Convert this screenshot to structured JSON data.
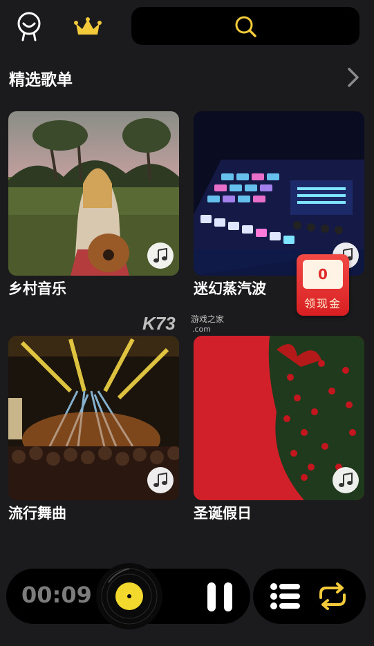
{
  "header": {
    "profile_icon": "user-icon",
    "vip_icon": "crown-icon",
    "search_icon": "search-icon"
  },
  "section": {
    "title": "精选歌单",
    "more_icon": "chevron-right-icon"
  },
  "playlists": [
    {
      "label": "乡村音乐",
      "icon": "music-note-icon"
    },
    {
      "label": "迷幻蒸汽波",
      "icon": "music-note-icon"
    },
    {
      "label": "流行舞曲",
      "icon": "music-note-icon"
    },
    {
      "label": "圣诞假日",
      "icon": "music-note-icon"
    }
  ],
  "cash_badge": {
    "count": "0",
    "label": "领现金"
  },
  "watermark": {
    "brand": "K73",
    "text": "游戏之家",
    "domain": ".com"
  },
  "player": {
    "time": "00:09",
    "disc_icon": "vinyl-disc-icon",
    "pause_icon": "pause-icon",
    "playlist_icon": "list-icon",
    "repeat_icon": "repeat-icon"
  },
  "colors": {
    "background": "#1b1b1d",
    "accent": "#f3cb3a",
    "badge": "#e02a2a"
  }
}
